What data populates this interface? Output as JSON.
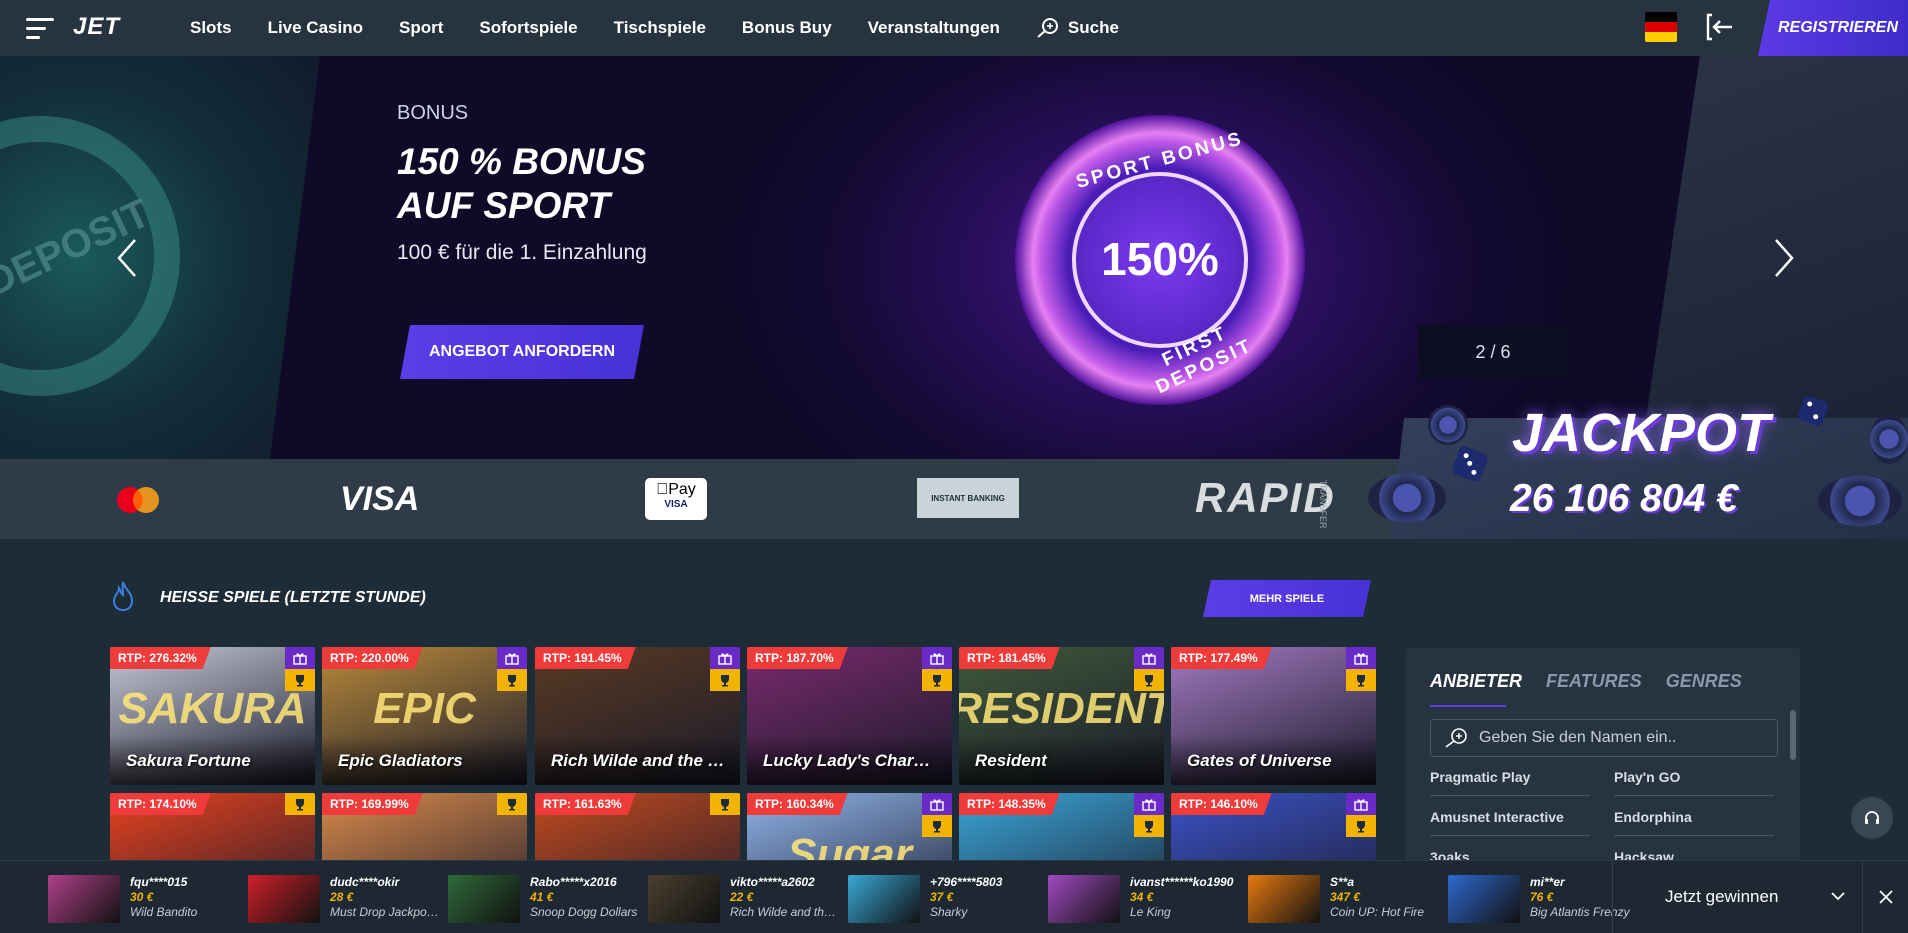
{
  "header": {
    "logo": "JET",
    "nav": [
      "Slots",
      "Live Casino",
      "Sport",
      "Sofortspiele",
      "Tischspiele",
      "Bonus Buy",
      "Veranstaltungen"
    ],
    "search_label": "Suche",
    "register_label": "REGISTRIEREN",
    "language": "de"
  },
  "hero": {
    "label": "BONUS",
    "title_line1": "150 % BONUS",
    "title_line2": "AUF SPORT",
    "subtitle": "100 € für die 1. Einzahlung",
    "cta_label": "ANGEBOT ANFORDERN",
    "counter": "2 / 6",
    "medallion_top": "SPORT BONUS",
    "medallion_value": "150%",
    "medallion_bottom": "FIRST DEPOSIT",
    "left_slide_text": "DEPOSIT"
  },
  "payments": {
    "mastercard": "mastercard",
    "visa": "VISA",
    "applepay": "Pay",
    "applepay_sub": "VISA",
    "instant_banking": "INSTANT BANKING",
    "rapid": "RAPID",
    "rapid_sub": "TRANSFER"
  },
  "jackpot": {
    "title": "JACKPOT",
    "amount": "26 106 804 €"
  },
  "hot_games": {
    "title": "HEISSE SPIELE (LETZTE STUNDE)",
    "more_label": "MEHR SPIELE",
    "row1": [
      {
        "rtp": "RTP: 276.32%",
        "name": "Sakura Fortune",
        "art": "SAKURA",
        "bg": "#c6c9d6"
      },
      {
        "rtp": "RTP: 220.00%",
        "name": "Epic Gladiators",
        "art": "EPIC",
        "bg": "#b98a3a"
      },
      {
        "rtp": "RTP: 191.45%",
        "name": "Rich Wilde and the To…",
        "art": "",
        "bg": "#5a3a22"
      },
      {
        "rtp": "RTP: 187.70%",
        "name": "Lucky Lady's Charm d…",
        "art": "",
        "bg": "#7a2a6e"
      },
      {
        "rtp": "RTP: 181.45%",
        "name": "Resident",
        "art": "RESIDENT",
        "bg": "#3f5a3a"
      },
      {
        "rtp": "RTP: 177.49%",
        "name": "Gates of Universe",
        "art": "",
        "bg": "#a27ac0"
      }
    ],
    "row2": [
      {
        "rtp": "RTP: 174.10%",
        "bg": "#e8421e"
      },
      {
        "rtp": "RTP: 169.99%",
        "bg": "#d98a4a"
      },
      {
        "rtp": "RTP: 161.63%",
        "bg": "#c24a1e"
      },
      {
        "rtp": "RTP: 160.34%",
        "art": "Sugar",
        "bg": "#8fb4ea"
      },
      {
        "rtp": "RTP: 148.35%",
        "bg": "#3aa6d8"
      },
      {
        "rtp": "RTP: 146.10%",
        "bg": "#3b52c6"
      }
    ]
  },
  "providers": {
    "tabs": [
      "ANBIETER",
      "FEATURES",
      "GENRES"
    ],
    "search_placeholder": "Geben Sie den Namen ein..",
    "items": [
      "Pragmatic Play",
      "Play'n GO",
      "Amusnet Interactive",
      "Endorphina",
      "3oaks",
      "Hacksaw"
    ]
  },
  "winners": {
    "items": [
      {
        "user": "fqu****015",
        "amount": "30 €",
        "game": "Wild Bandito",
        "color": "#b0408a"
      },
      {
        "user": "dudc****okir",
        "amount": "28 €",
        "game": "Must Drop Jackpo…",
        "color": "#d0202a"
      },
      {
        "user": "Rabo*****x2016",
        "amount": "41 €",
        "game": "Snoop Dogg Dollars",
        "color": "#2f6a3a"
      },
      {
        "user": "vikto*****a2602",
        "amount": "22 €",
        "game": "Rich Wilde and th…",
        "color": "#4a4030"
      },
      {
        "user": "+796****5803",
        "amount": "37 €",
        "game": "Sharky",
        "color": "#3aa8d8"
      },
      {
        "user": "ivanst******ko1990",
        "amount": "34 €",
        "game": "Le King",
        "color": "#a04ac0"
      },
      {
        "user": "S**a",
        "amount": "347 €",
        "game": "Coin UP: Hot Fire",
        "color": "#e87a10"
      },
      {
        "user": "mi**er",
        "amount": "76 €",
        "game": "Big Atlantis Frenzy",
        "color": "#2c6ad0"
      }
    ],
    "toggle_label": "Jetzt gewinnen"
  }
}
